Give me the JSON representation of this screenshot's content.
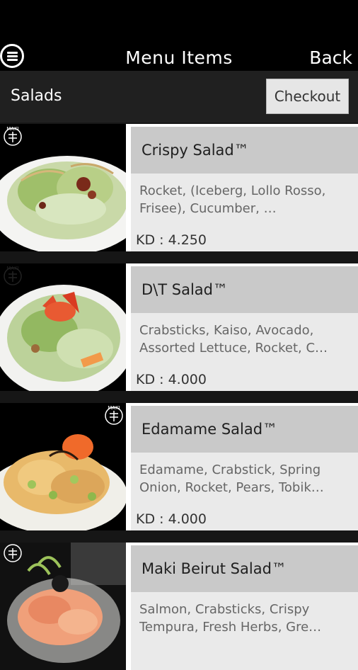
{
  "header": {
    "title": "Menu Items",
    "back_label": "Back"
  },
  "section": {
    "title": "Salads",
    "checkout_label": "Checkout"
  },
  "items": [
    {
      "name": "Crispy Salad™",
      "description": "Rocket, (Iceberg, Lollo Rosso, Frisee), Cucumber, …",
      "price": "KD : 4.250"
    },
    {
      "name": "D\\T Salad™",
      "description": "Crabsticks, Kaiso, Avocado, Assorted Lettuce, Rocket, C…",
      "price": "KD : 4.000"
    },
    {
      "name": "Edamame Salad™",
      "description": "Edamame, Crabstick, Spring Onion, Rocket, Pears, Tobik…",
      "price": "KD : 4.000"
    },
    {
      "name": "Maki Beirut Salad™",
      "description": "Salmon, Crabsticks, Crispy Tempura, Fresh Herbs, Gre…",
      "price": ""
    }
  ],
  "brand": {
    "logo_text": "MAKI"
  },
  "icons": {
    "menu": "hamburger-menu-icon"
  },
  "colors": {
    "app_bar": "#000000",
    "name_bar": "#c9c9c9",
    "desc_box": "#eaeaea",
    "checkout_bg": "#e6e6e6"
  }
}
